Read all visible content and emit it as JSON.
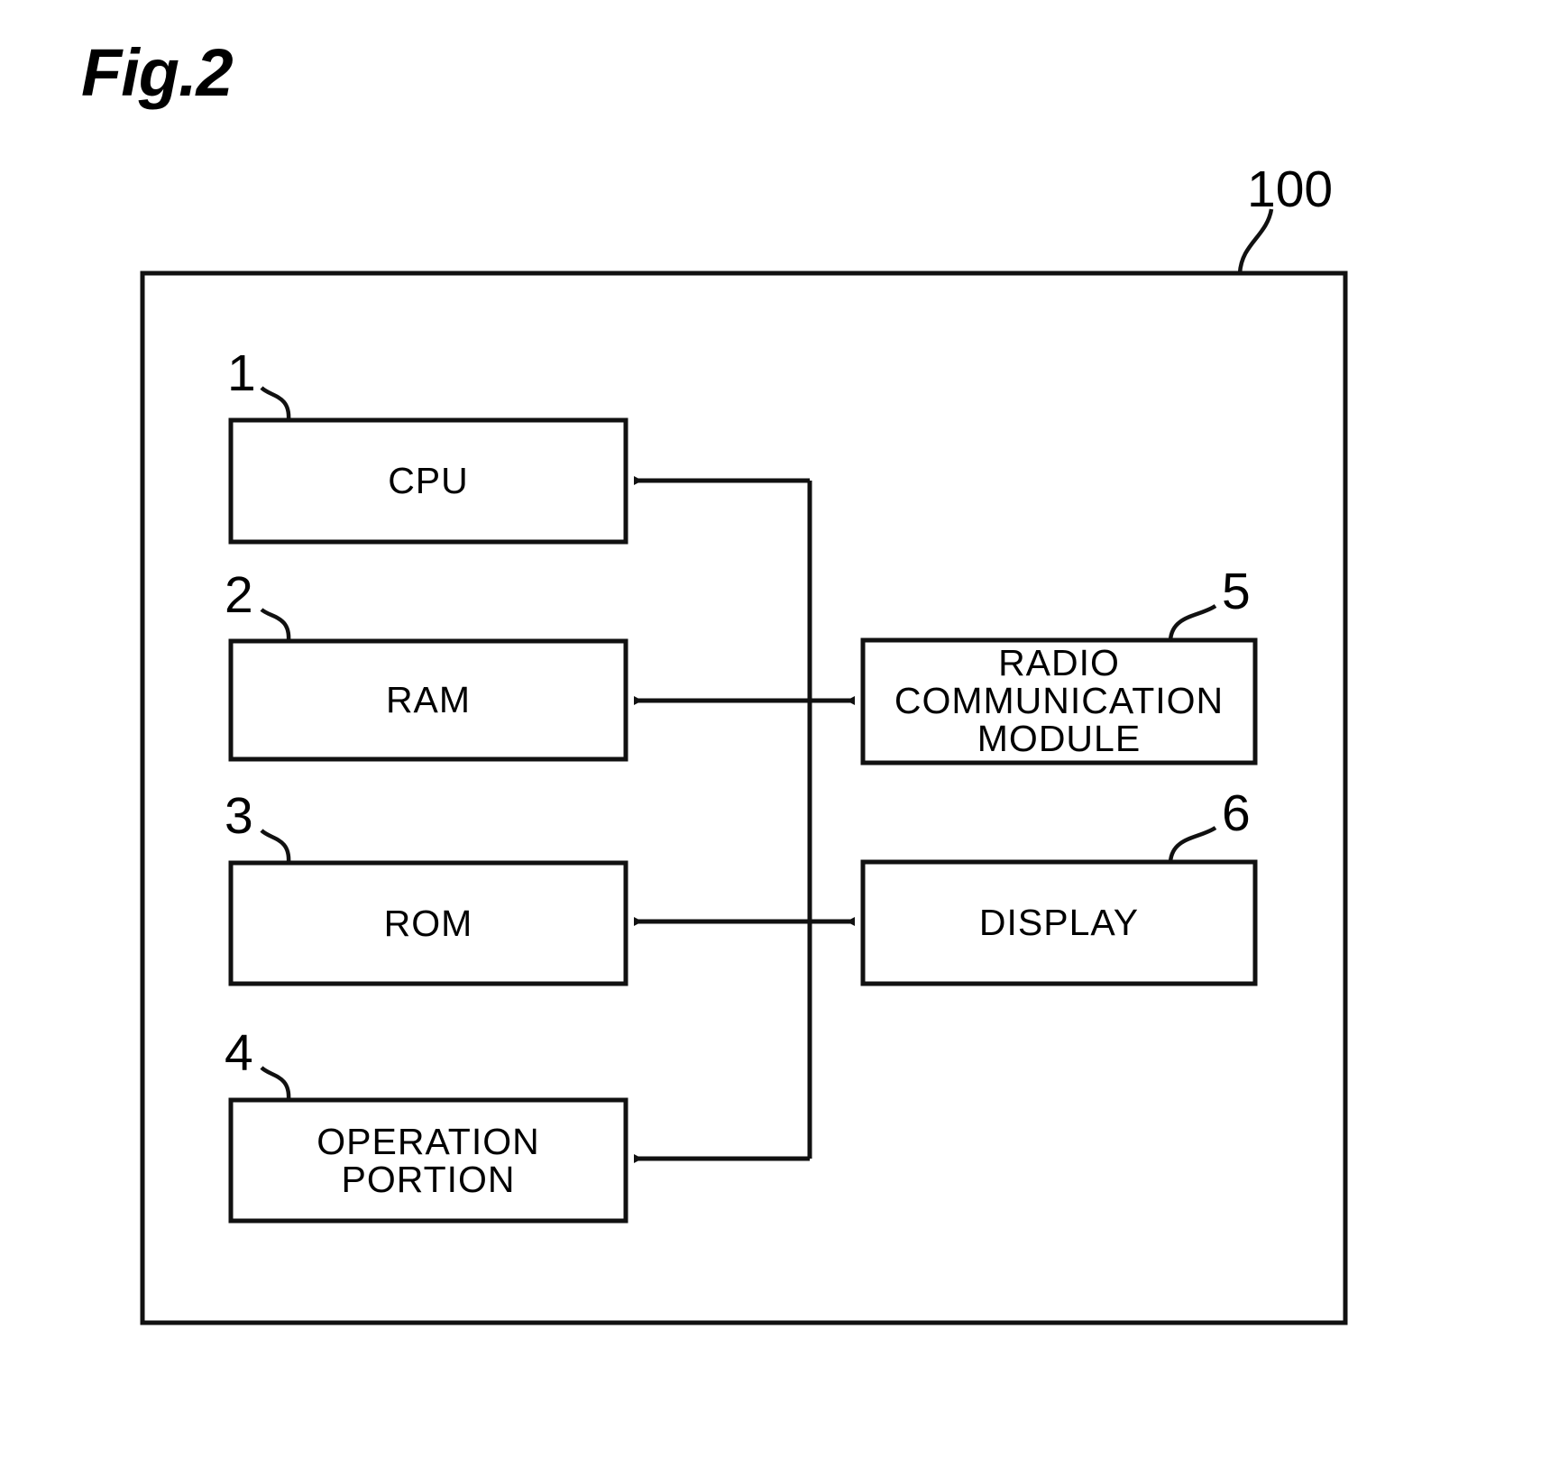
{
  "figure": {
    "title": "Fig.2",
    "device_reference": "100"
  },
  "blocks": [
    {
      "id": "cpu",
      "label": "CPU",
      "ref": "1"
    },
    {
      "id": "ram",
      "label": "RAM",
      "ref": "2"
    },
    {
      "id": "rom",
      "label": "ROM",
      "ref": "3"
    },
    {
      "id": "op",
      "label": "OPERATION\nPORTION",
      "ref": "4"
    },
    {
      "id": "radio",
      "label": "RADIO\nCOMMUNICATION\nMODULE",
      "ref": "5"
    },
    {
      "id": "display",
      "label": "DISPLAY",
      "ref": "6"
    }
  ],
  "connections": [
    {
      "from": "bus",
      "to": "cpu",
      "arrow": "single"
    },
    {
      "from": "ram",
      "to": "radio",
      "arrow": "double"
    },
    {
      "from": "rom",
      "to": "display",
      "arrow": "double"
    },
    {
      "from": "bus",
      "to": "op",
      "arrow": "single"
    }
  ],
  "colors": {
    "stroke": "#111111",
    "background": "#ffffff"
  }
}
